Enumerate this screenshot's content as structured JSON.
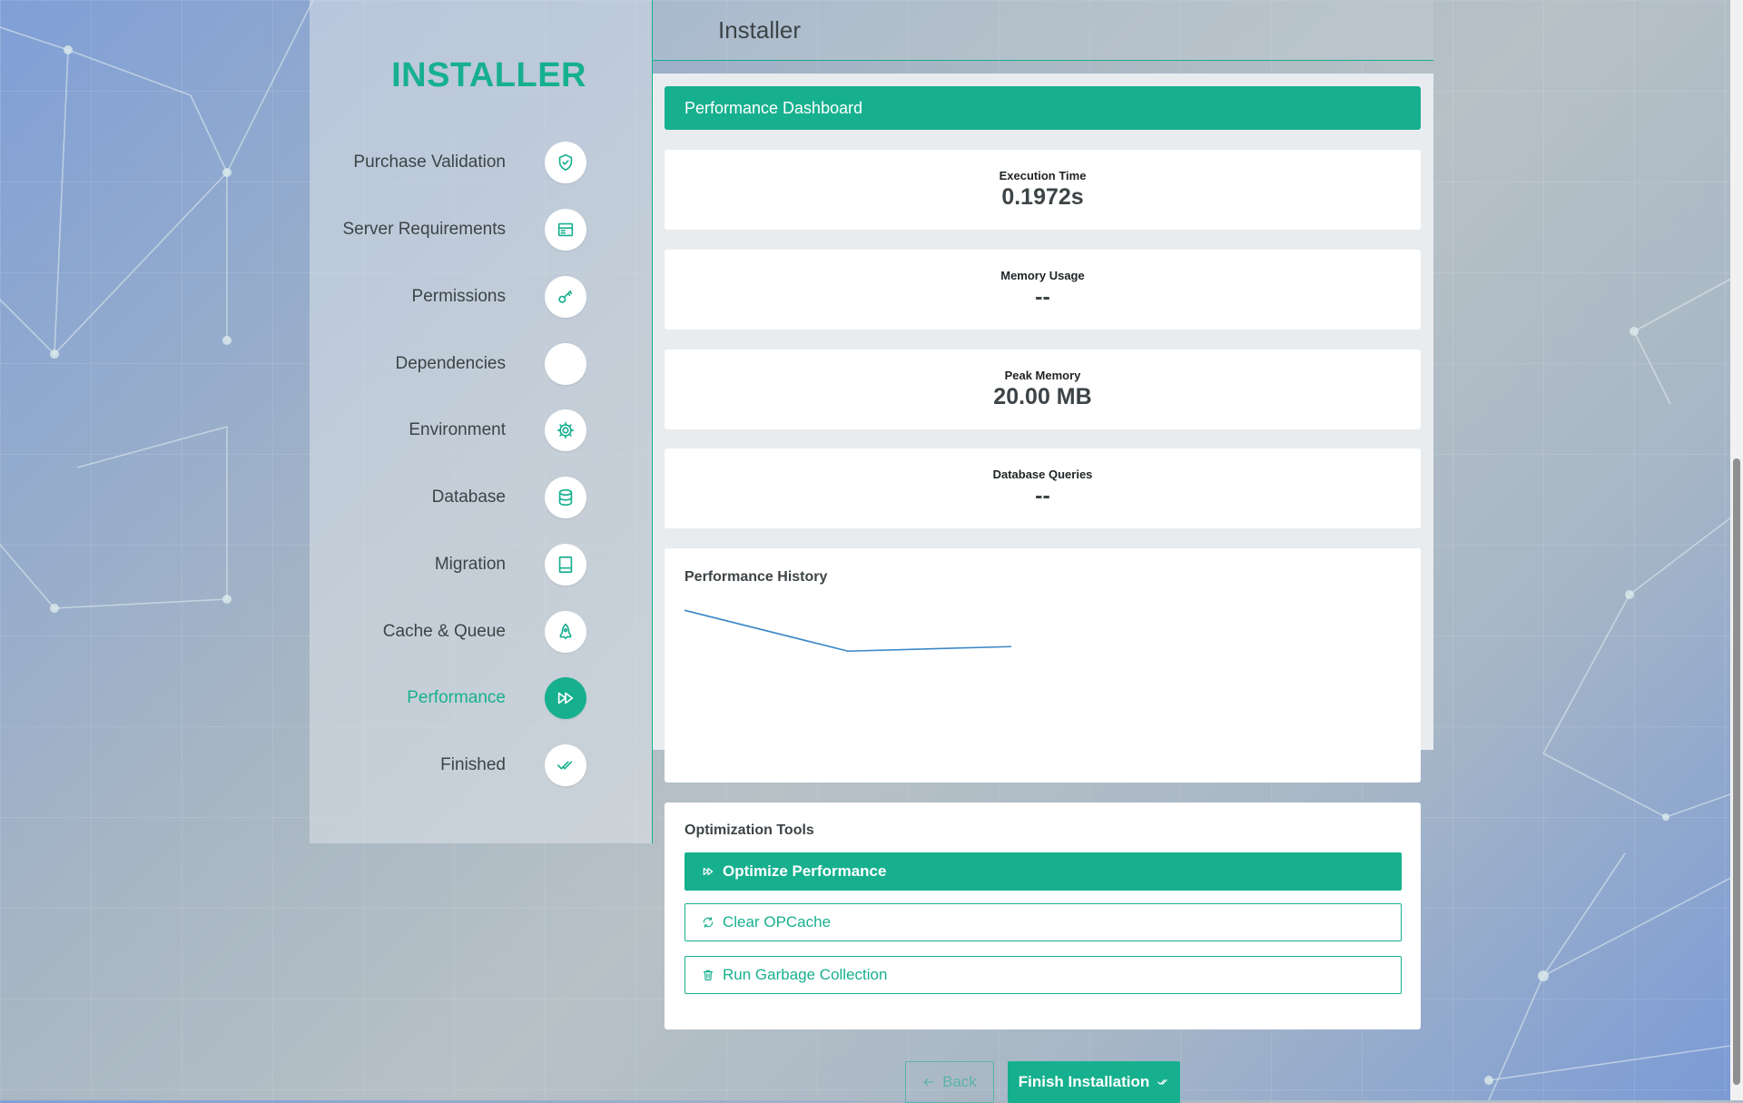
{
  "sidebar": {
    "brand": "INSTALLER",
    "steps": [
      {
        "label": "Purchase Validation",
        "icon": "shield-check-icon"
      },
      {
        "label": "Server Requirements",
        "icon": "server-icon"
      },
      {
        "label": "Permissions",
        "icon": "key-icon"
      },
      {
        "label": "Dependencies",
        "icon": "box-icon"
      },
      {
        "label": "Environment",
        "icon": "gear-icon"
      },
      {
        "label": "Database",
        "icon": "database-icon"
      },
      {
        "label": "Migration",
        "icon": "hard-drive-icon"
      },
      {
        "label": "Cache & Queue",
        "icon": "rocket-icon"
      },
      {
        "label": "Performance",
        "icon": "fast-forward-icon",
        "active": true
      },
      {
        "label": "Finished",
        "icon": "double-check-icon"
      }
    ]
  },
  "header": {
    "title": "Installer"
  },
  "dashboard": {
    "title": "Performance Dashboard",
    "stats": [
      {
        "name": "Execution Time",
        "value": "0.1972s"
      },
      {
        "name": "Memory Usage",
        "value": "--"
      },
      {
        "name": "Peak Memory",
        "value": "20.00 MB"
      },
      {
        "name": "Database Queries",
        "value": "--"
      }
    ]
  },
  "history": {
    "title": "Performance History",
    "line_color": "#3a87c8",
    "points": [
      0.95,
      0.59,
      0.63
    ]
  },
  "tools": {
    "title": "Optimization Tools",
    "optimize": "Optimize Performance",
    "clear_opcache": "Clear OPCache",
    "garbage": "Run Garbage Collection"
  },
  "nav": {
    "back": "Back",
    "finish": "Finish Installation"
  },
  "colors": {
    "accent": "#17b08f",
    "text": "#3d4447",
    "panel": "#e9ecef"
  }
}
